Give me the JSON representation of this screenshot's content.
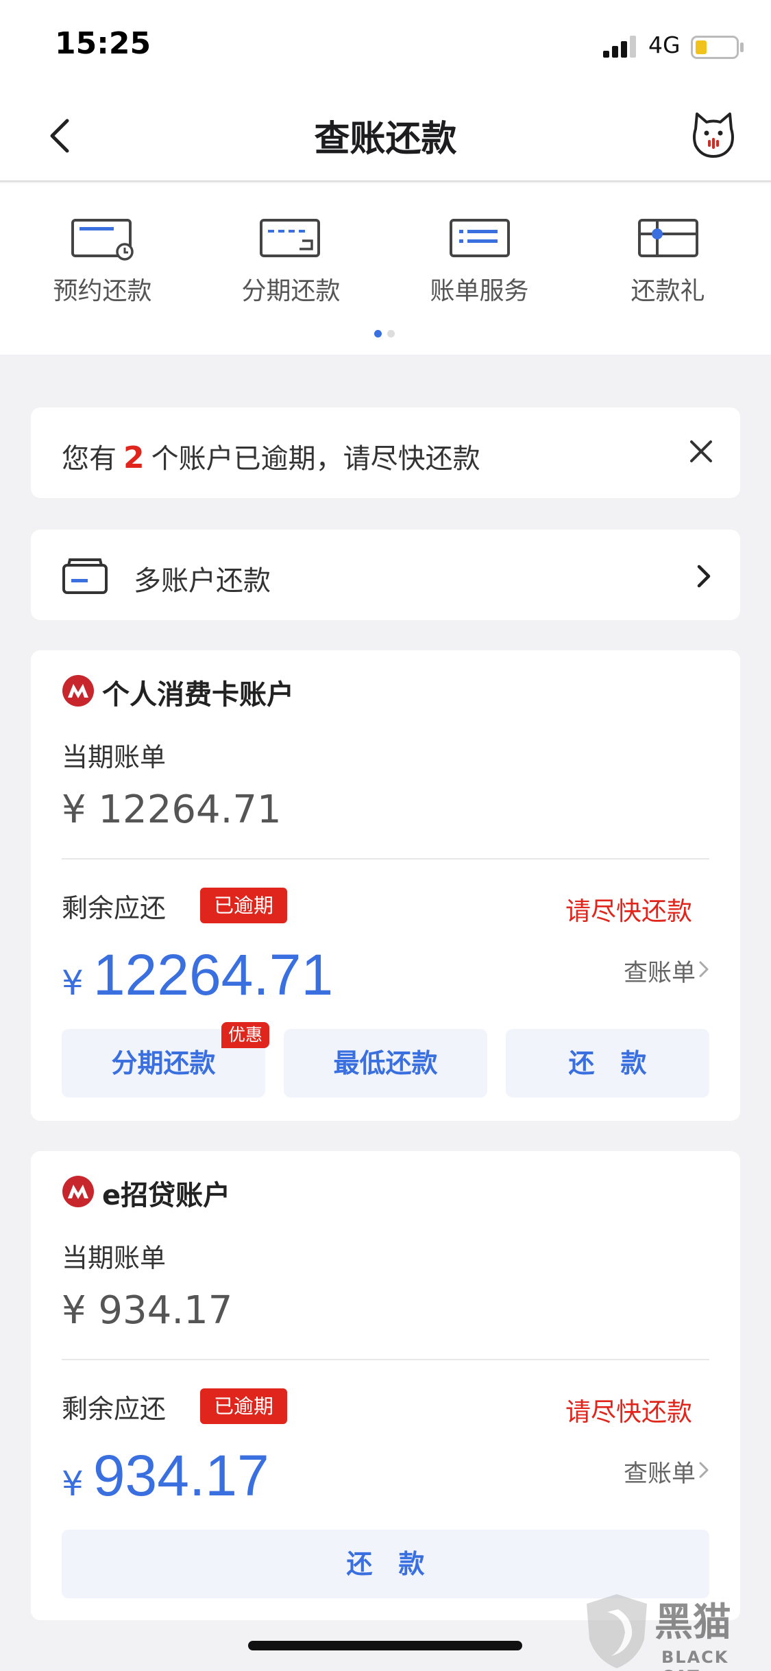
{
  "status_bar": {
    "time": "15:25",
    "network": "4G"
  },
  "nav": {
    "title": "查账还款"
  },
  "quick_actions": [
    {
      "label": "预约还款",
      "icon": "card-clock-icon"
    },
    {
      "label": "分期还款",
      "icon": "card-installment-icon"
    },
    {
      "label": "账单服务",
      "icon": "bill-list-icon"
    },
    {
      "label": "还款礼",
      "icon": "gift-card-icon"
    }
  ],
  "notice": {
    "prefix": "您有",
    "count": "2",
    "suffix": "个账户已逾期，请尽快还款"
  },
  "multi_account": {
    "label": "多账户还款"
  },
  "accounts": [
    {
      "name": "个人消费卡账户",
      "current_label": "当期账单",
      "current_amount": "¥ 12264.71",
      "remaining_label": "剩余应还",
      "overdue_badge": "已逾期",
      "urge_text": "请尽快还款",
      "currency": "¥",
      "remaining_amount": "12264.71",
      "bill_link": "查账单",
      "buttons": {
        "installment": "分期还款",
        "minimum": "最低还款",
        "repay": "还　款"
      },
      "promo_badge": "优惠"
    },
    {
      "name": "e招贷账户",
      "current_label": "当期账单",
      "current_amount": "¥ 934.17",
      "remaining_label": "剩余应还",
      "overdue_badge": "已逾期",
      "urge_text": "请尽快还款",
      "currency": "¥",
      "remaining_amount": "934.17",
      "bill_link": "查账单",
      "buttons": {
        "repay": "还　款"
      }
    }
  ],
  "watermark": {
    "cn": "黑猫",
    "en": "BLACK CAT"
  },
  "colors": {
    "accent": "#3a6fe0",
    "danger": "#e0251c",
    "background": "#f2f2f4"
  }
}
